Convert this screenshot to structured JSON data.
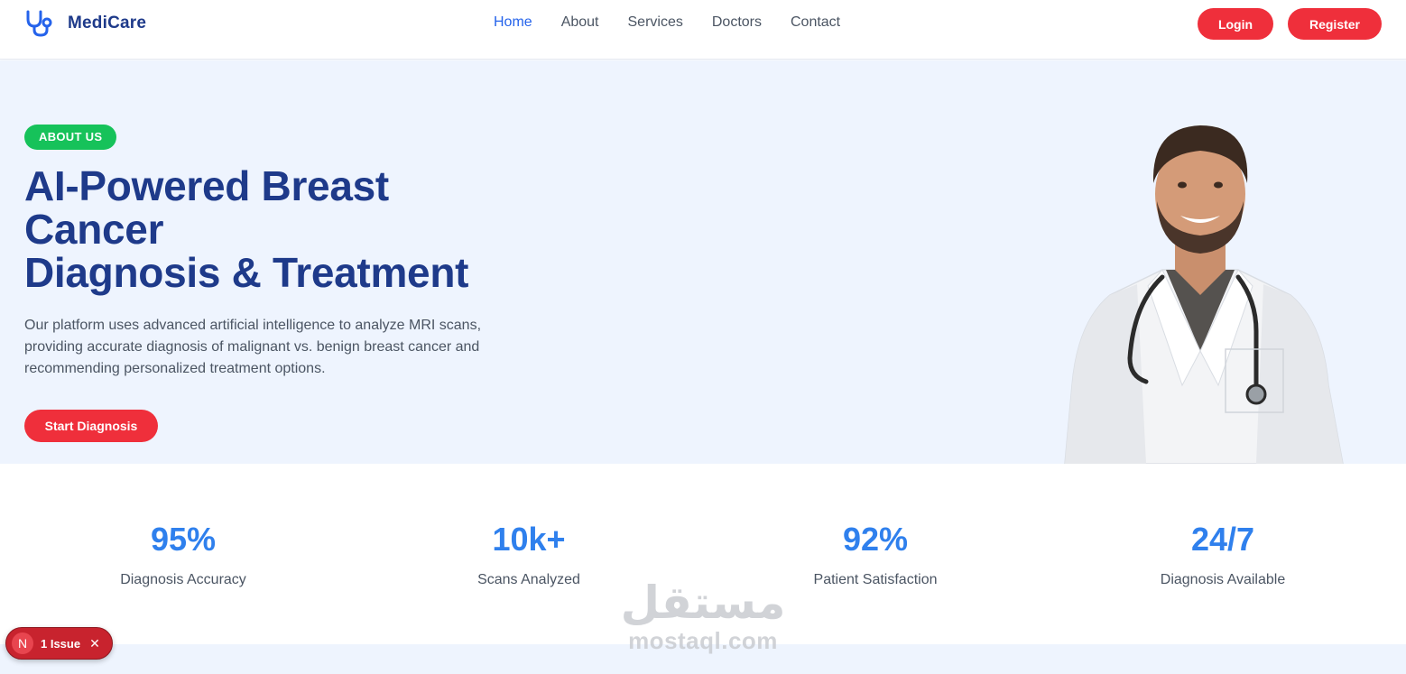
{
  "brand": {
    "name": "MediCare",
    "icon": "stethoscope-icon"
  },
  "nav": {
    "items": [
      {
        "label": "Home",
        "active": true
      },
      {
        "label": "About",
        "active": false
      },
      {
        "label": "Services",
        "active": false
      },
      {
        "label": "Doctors",
        "active": false
      },
      {
        "label": "Contact",
        "active": false
      }
    ],
    "login_label": "Login",
    "register_label": "Register"
  },
  "hero": {
    "badge": "ABOUT US",
    "title_lines": [
      "AI-Powered Breast",
      "Cancer",
      "Diagnosis & Treatment"
    ],
    "description": "Our platform uses advanced artificial intelligence to analyze MRI scans, providing accurate diagnosis of malignant vs. benign breast cancer and recommending personalized treatment options.",
    "cta_label": "Start Diagnosis"
  },
  "stats": [
    {
      "value": "95%",
      "label": "Diagnosis Accuracy"
    },
    {
      "value": "10k+",
      "label": "Scans Analyzed"
    },
    {
      "value": "92%",
      "label": "Patient Satisfaction"
    },
    {
      "value": "24/7",
      "label": "Diagnosis Available"
    }
  ],
  "watermark": {
    "arabic": "مستقل",
    "latin": "mostaql.com"
  },
  "issue_overlay": {
    "initial": "N",
    "label": "1 Issue",
    "close": "✕"
  },
  "colors": {
    "primary_dark": "#1e3a8a",
    "accent_blue": "#2f80ed",
    "button_red": "#ef2f3b",
    "badge_green": "#16c25a",
    "hero_bg": "#eef4fe"
  }
}
